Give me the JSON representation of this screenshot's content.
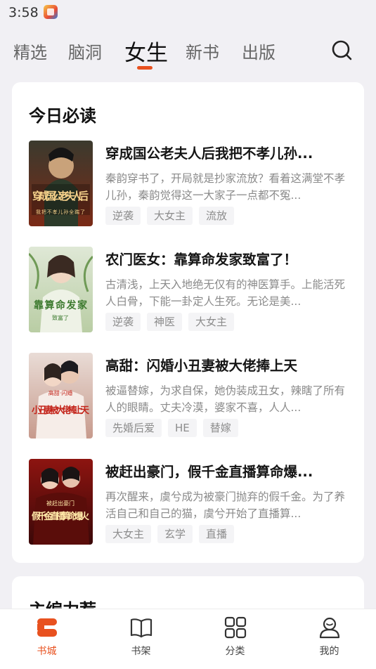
{
  "status_bar": {
    "time": "3:58"
  },
  "top_tabs": [
    {
      "label": "精选",
      "active": false
    },
    {
      "label": "脑洞",
      "active": false
    },
    {
      "label": "女生",
      "active": true
    },
    {
      "label": "新书",
      "active": false
    },
    {
      "label": "出版",
      "active": false
    }
  ],
  "search_icon": "search-icon",
  "section_today": {
    "title": "今日必读",
    "books": [
      {
        "title": "穿成国公老夫人后我把不孝儿孙...",
        "desc": "秦韵穿书了，开局就是抄家流放？看着这满堂不孝儿孙，秦韵觉得这一大家子一点都不冤...",
        "tags": [
          "逆袭",
          "大女主",
          "流放"
        ],
        "cover_text": "穿成国公老夫人后",
        "cover_sub": "我把不孝儿孙全踹了"
      },
      {
        "title": "农门医女：靠算命发家致富了！",
        "desc": "古清浅，上天入地绝无仅有的神医算手。上能活死人白骨，下能一卦定人生死。无论是美...",
        "tags": [
          "逆袭",
          "神医",
          "大女主"
        ],
        "cover_text": "靠算命发家",
        "cover_sub": "致富了"
      },
      {
        "title": "高甜：闪婚小丑妻被大佬捧上天",
        "desc": "被逼替嫁，为求自保，她伪装成丑女，辣瞎了所有人的眼睛。丈夫冷漠，婆家不喜，人人...",
        "tags": [
          "先婚后爱",
          "HE",
          "替嫁"
        ],
        "cover_text": "小丑妻被大佬捧上天",
        "cover_sub": "高甜·闪婚"
      },
      {
        "title": "被赶出豪门，假千金直播算命爆...",
        "desc": "再次醒来，虞兮成为被豪门抛弃的假千金。为了养活自己和自己的猫，虞兮开始了直播算...",
        "tags": [
          "大女主",
          "玄学",
          "直播"
        ],
        "cover_text": "假千金直播算命爆火",
        "cover_sub": "被赶出豪门"
      }
    ]
  },
  "section_editor": {
    "title": "主编力荐"
  },
  "bottom_nav": [
    {
      "label": "书城",
      "icon": "bookstore-icon",
      "active": true
    },
    {
      "label": "书架",
      "icon": "bookshelf-icon",
      "active": false
    },
    {
      "label": "分类",
      "icon": "category-grid-icon",
      "active": false
    },
    {
      "label": "我的",
      "icon": "profile-icon",
      "active": false
    }
  ],
  "colors": {
    "accent": "#e8511f",
    "background": "#f1f0f4",
    "card": "#ffffff"
  }
}
